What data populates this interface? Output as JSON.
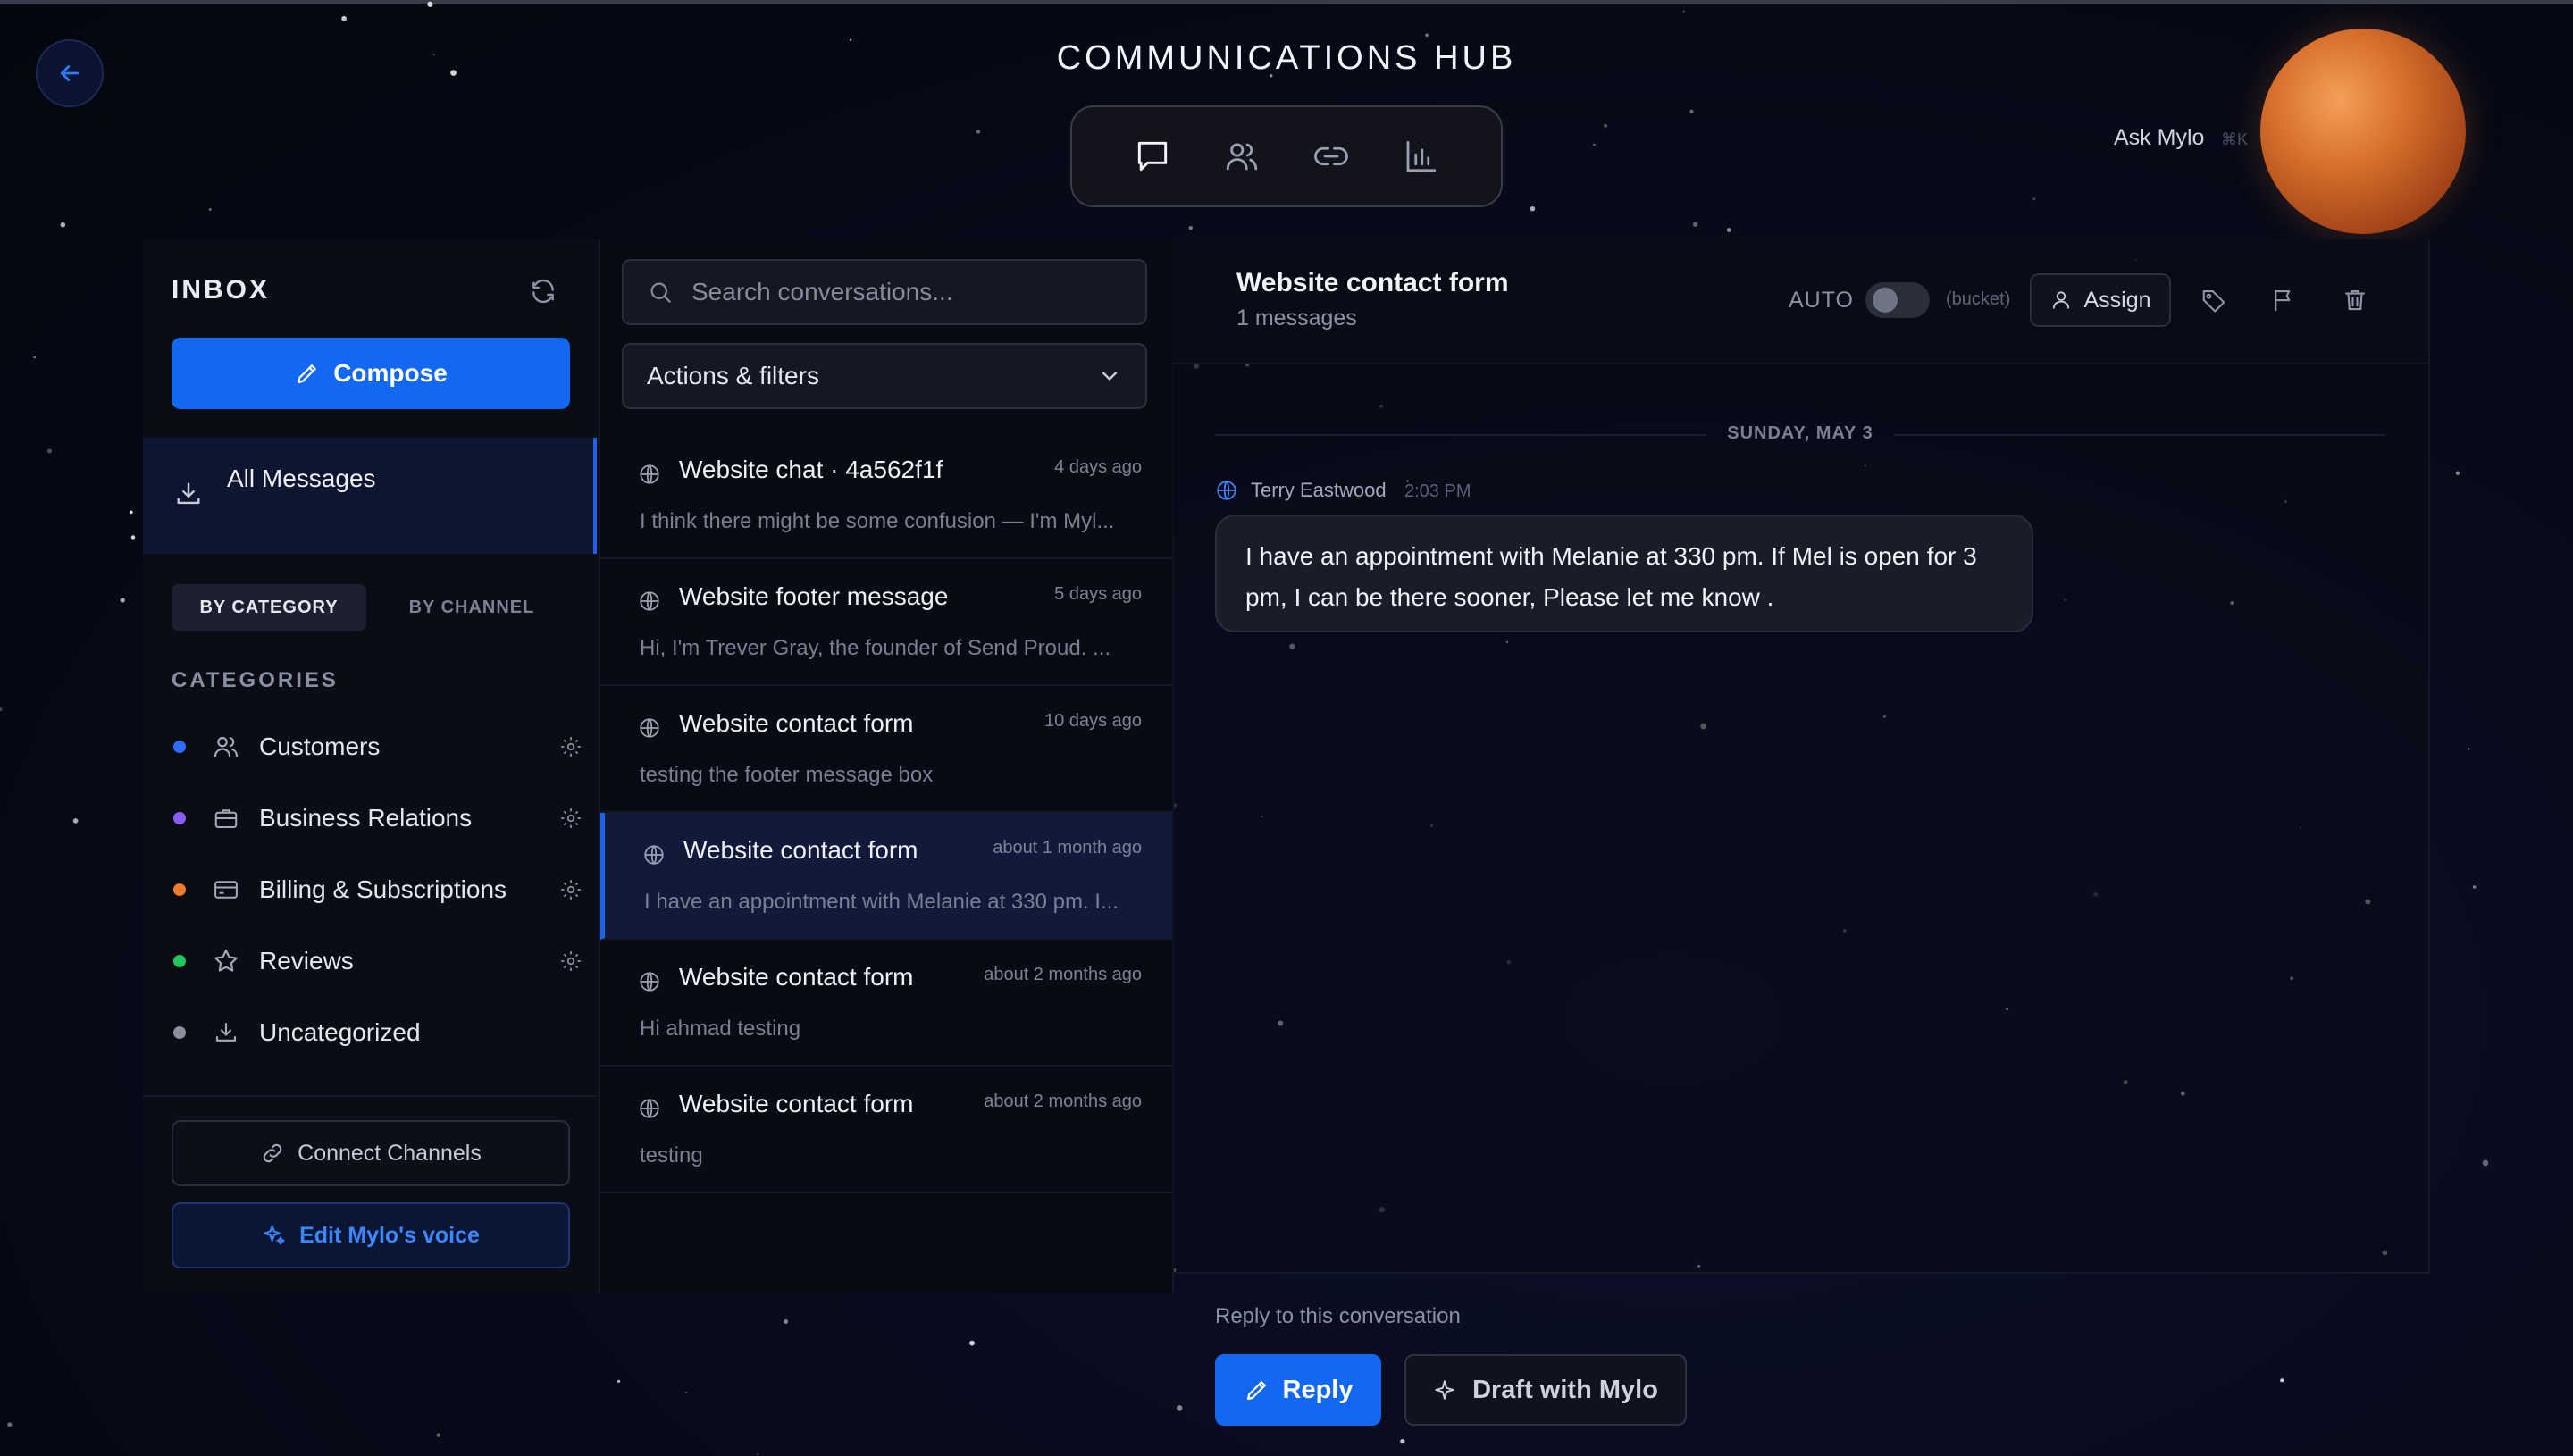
{
  "header": {
    "title": "COMMUNICATIONS HUB",
    "ask_label": "Ask Mylo",
    "ask_shortcut": "⌘K"
  },
  "nav": {
    "items": [
      {
        "name": "chat-icon",
        "active": true
      },
      {
        "name": "users-icon",
        "active": false
      },
      {
        "name": "link-icon",
        "active": false
      },
      {
        "name": "chart-icon",
        "active": false
      }
    ]
  },
  "sidebar": {
    "title": "INBOX",
    "compose_label": "Compose",
    "all_messages_label": "All Messages",
    "segments": [
      "BY CATEGORY",
      "BY CHANNEL"
    ],
    "categories_heading": "CATEGORIES",
    "categories": [
      {
        "label": "Customers",
        "color": "#2f6bff",
        "icon": "users-icon"
      },
      {
        "label": "Business Relations",
        "color": "#8b5cf6",
        "icon": "briefcase-icon"
      },
      {
        "label": "Billing & Subscriptions",
        "color": "#f07a2a",
        "icon": "credit-card-icon"
      },
      {
        "label": "Reviews",
        "color": "#22c55e",
        "icon": "star-icon"
      },
      {
        "label": "Uncategorized",
        "color": "#8a8f9c",
        "icon": "inbox-icon"
      }
    ],
    "connect_label": "Connect Channels",
    "voice_label": "Edit Mylo's voice"
  },
  "conversations": {
    "search_placeholder": "Search conversations...",
    "filters_label": "Actions & filters",
    "items": [
      {
        "title": "Website chat · 4a562f1f",
        "time": "4 days ago",
        "preview": "I think there might be some confusion — I'm Myl..."
      },
      {
        "title": "Website footer message",
        "time": "5 days ago",
        "preview": "Hi, I'm Trever Gray, the founder of Send Proud. ..."
      },
      {
        "title": "Website contact form",
        "time": "10 days ago",
        "preview": "testing the footer message box"
      },
      {
        "title": "Website contact form",
        "time": "about 1 month ago",
        "preview": "I have an appointment with Melanie at 330 pm. I..."
      },
      {
        "title": "Website contact form",
        "time": "about 2 months ago",
        "preview": "Hi ahmad testing"
      },
      {
        "title": "Website contact form",
        "time": "about 2 months ago",
        "preview": "testing"
      }
    ]
  },
  "detail": {
    "title": "Website contact form",
    "subtitle": "1 messages",
    "auto_label": "AUTO",
    "bucket_label": "(bucket)",
    "assign_label": "Assign",
    "date_label": "SUNDAY, MAY 3",
    "message": {
      "sender": "Terry Eastwood",
      "time": "2:03 PM",
      "text": "I have an appointment with Melanie at 330 pm. If Mel is open for 3 pm, I can be there sooner, Please let me know ."
    },
    "reply_hint": "Reply to this conversation",
    "reply_label": "Reply",
    "draft_label": "Draft with Mylo"
  },
  "colors": {
    "accent": "#1268f0",
    "background": "#070a19"
  }
}
